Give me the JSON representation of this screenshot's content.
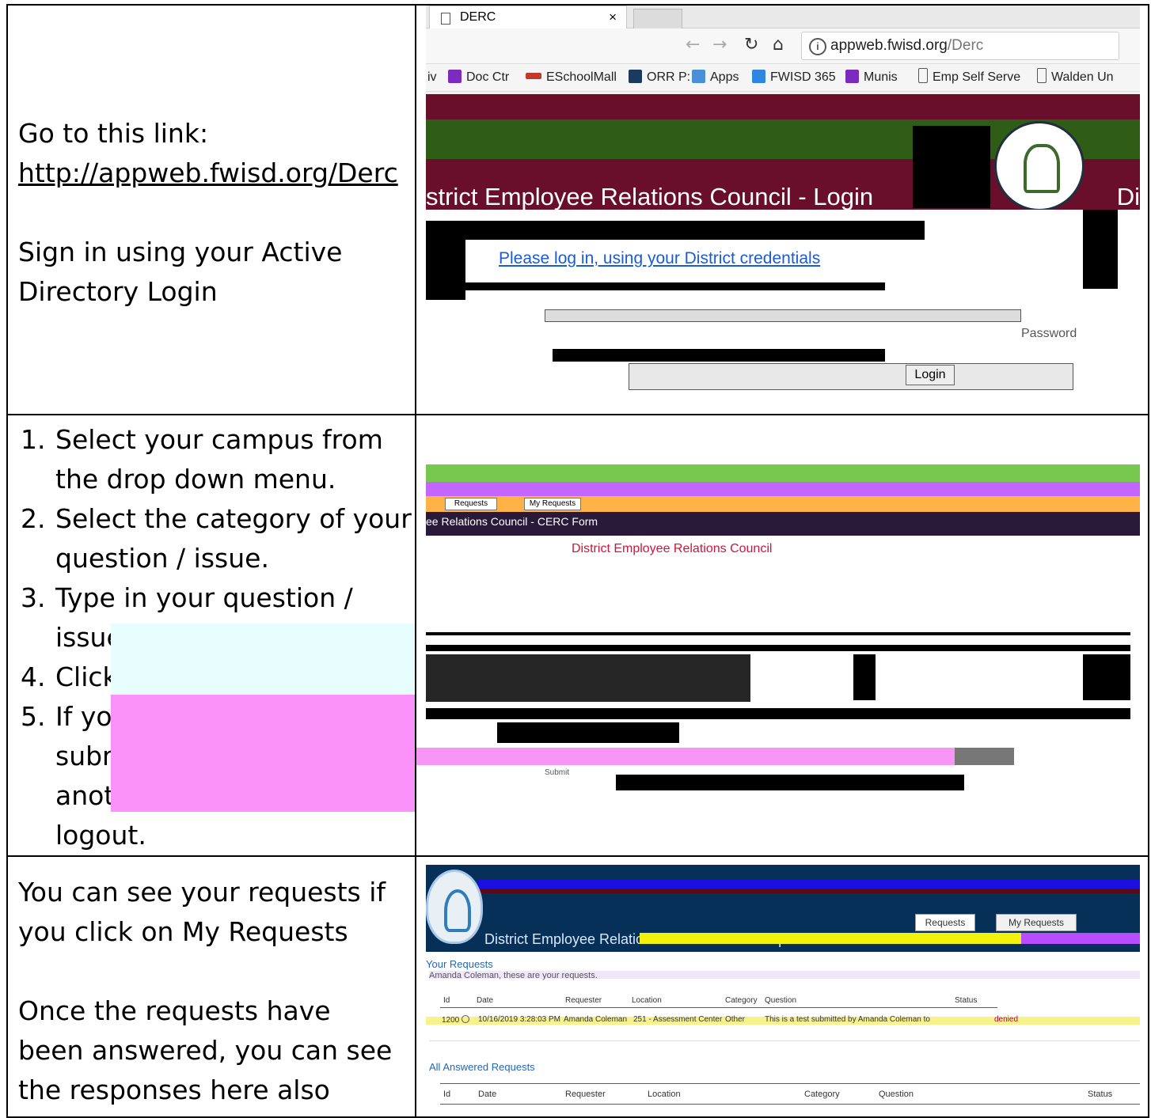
{
  "rows": [
    {
      "instructions": {
        "intro": "Go to this link:",
        "link": "http://appweb.fwisd.org/Derc",
        "signin": "Sign in using your Active Directory Login"
      },
      "browser": {
        "tab_title": "DERC",
        "tab_close": "×",
        "url_host": "appweb.fwisd.org",
        "url_path": "/Derc",
        "bookmarks": [
          "iv",
          "Doc Ctr",
          "ESchoolMall",
          "ORR P:",
          "Apps",
          "FWISD 365",
          "Munis",
          "Emp Self Serve",
          "Walden Un"
        ]
      },
      "login_page": {
        "title": "strict Employee Relations Council - Login",
        "title_right": "Di",
        "message": "Please log in, using your District credentials",
        "password_label": "Password",
        "login_button": "Login"
      }
    },
    {
      "steps": [
        "Select your campus from the drop down menu.",
        "Select the category of your question / issue.",
        "Type in your question / issue.",
        "Click Submit.",
        "If you have another submission, you can enter another, or, you can logout."
      ],
      "form_page": {
        "tab_requests": "Requests",
        "tab_my_requests": "My Requests",
        "header_title": "ee Relations Council - CERC Form",
        "council_title": "District Employee Relations Council",
        "submit_label": "Submit"
      }
    },
    {
      "instructions": {
        "line1": "You can see your requests if you click on My Requests",
        "line2": "Once the requests have been answered, you can see the responses here also"
      },
      "requests_page": {
        "btn_requests": "Requests",
        "btn_my_requests": "My Requests",
        "header_title": "District Employee Relations Council - Your Requests",
        "your_requests": "Your Requests",
        "subtitle": "Amanda Coleman, these are your requests.",
        "columns": [
          "Id",
          "Date",
          "Requester",
          "Location",
          "Category",
          "Question",
          "Status"
        ],
        "row": {
          "id": "1200",
          "date": "10/16/2019 3:28:03 PM",
          "requester": "Amanda Coleman",
          "location": "251 - Assessment Center",
          "category": "Other",
          "question": "This is a test submitted by Amanda Coleman to",
          "status": "denied"
        },
        "answered_title": "All Answered Requests",
        "answered_columns": [
          "Id",
          "Date",
          "Requester",
          "Location",
          "Category",
          "Question",
          "Status"
        ]
      }
    }
  ]
}
